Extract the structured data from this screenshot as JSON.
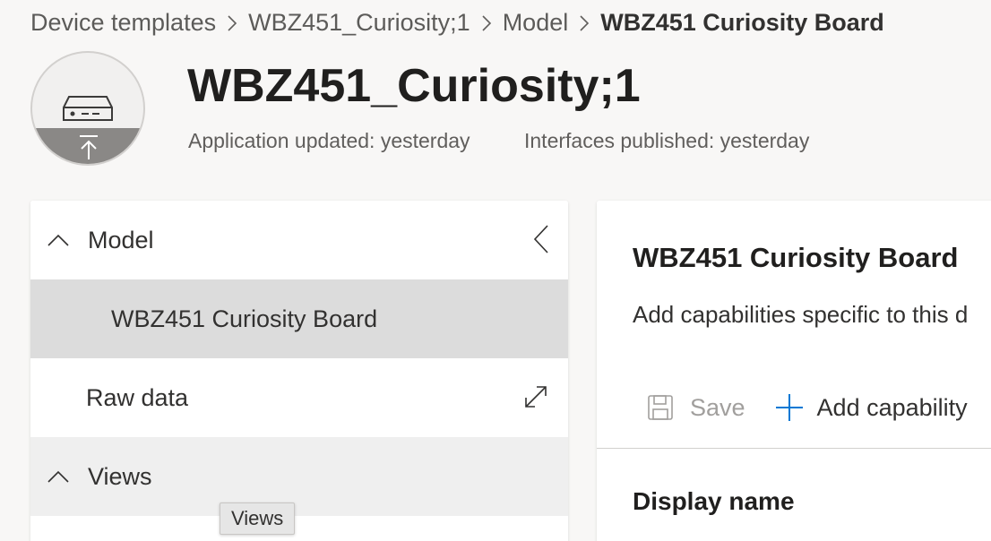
{
  "breadcrumb": {
    "items": [
      "Device templates",
      "WBZ451_Curiosity;1",
      "Model"
    ],
    "current": "WBZ451 Curiosity Board"
  },
  "header": {
    "title": "WBZ451_Curiosity;1",
    "app_updated": "Application updated: yesterday",
    "interfaces_published": "Interfaces published: yesterday",
    "avatar_icon": "device-icon",
    "upload_icon": "upload-icon"
  },
  "left_nav": {
    "model_label": "Model",
    "selected_item": "WBZ451 Curiosity Board",
    "raw_data_label": "Raw data",
    "views_label": "Views"
  },
  "tooltip": {
    "text": "Views"
  },
  "detail": {
    "title": "WBZ451 Curiosity Board",
    "description": "Add capabilities specific to this d",
    "save_label": "Save",
    "add_capability_label": "Add capability",
    "display_name_header": "Display name"
  },
  "colors": {
    "accent": "#0078d4",
    "selected_row": "#dcdcdc",
    "disabled_text": "#a19f9d"
  }
}
